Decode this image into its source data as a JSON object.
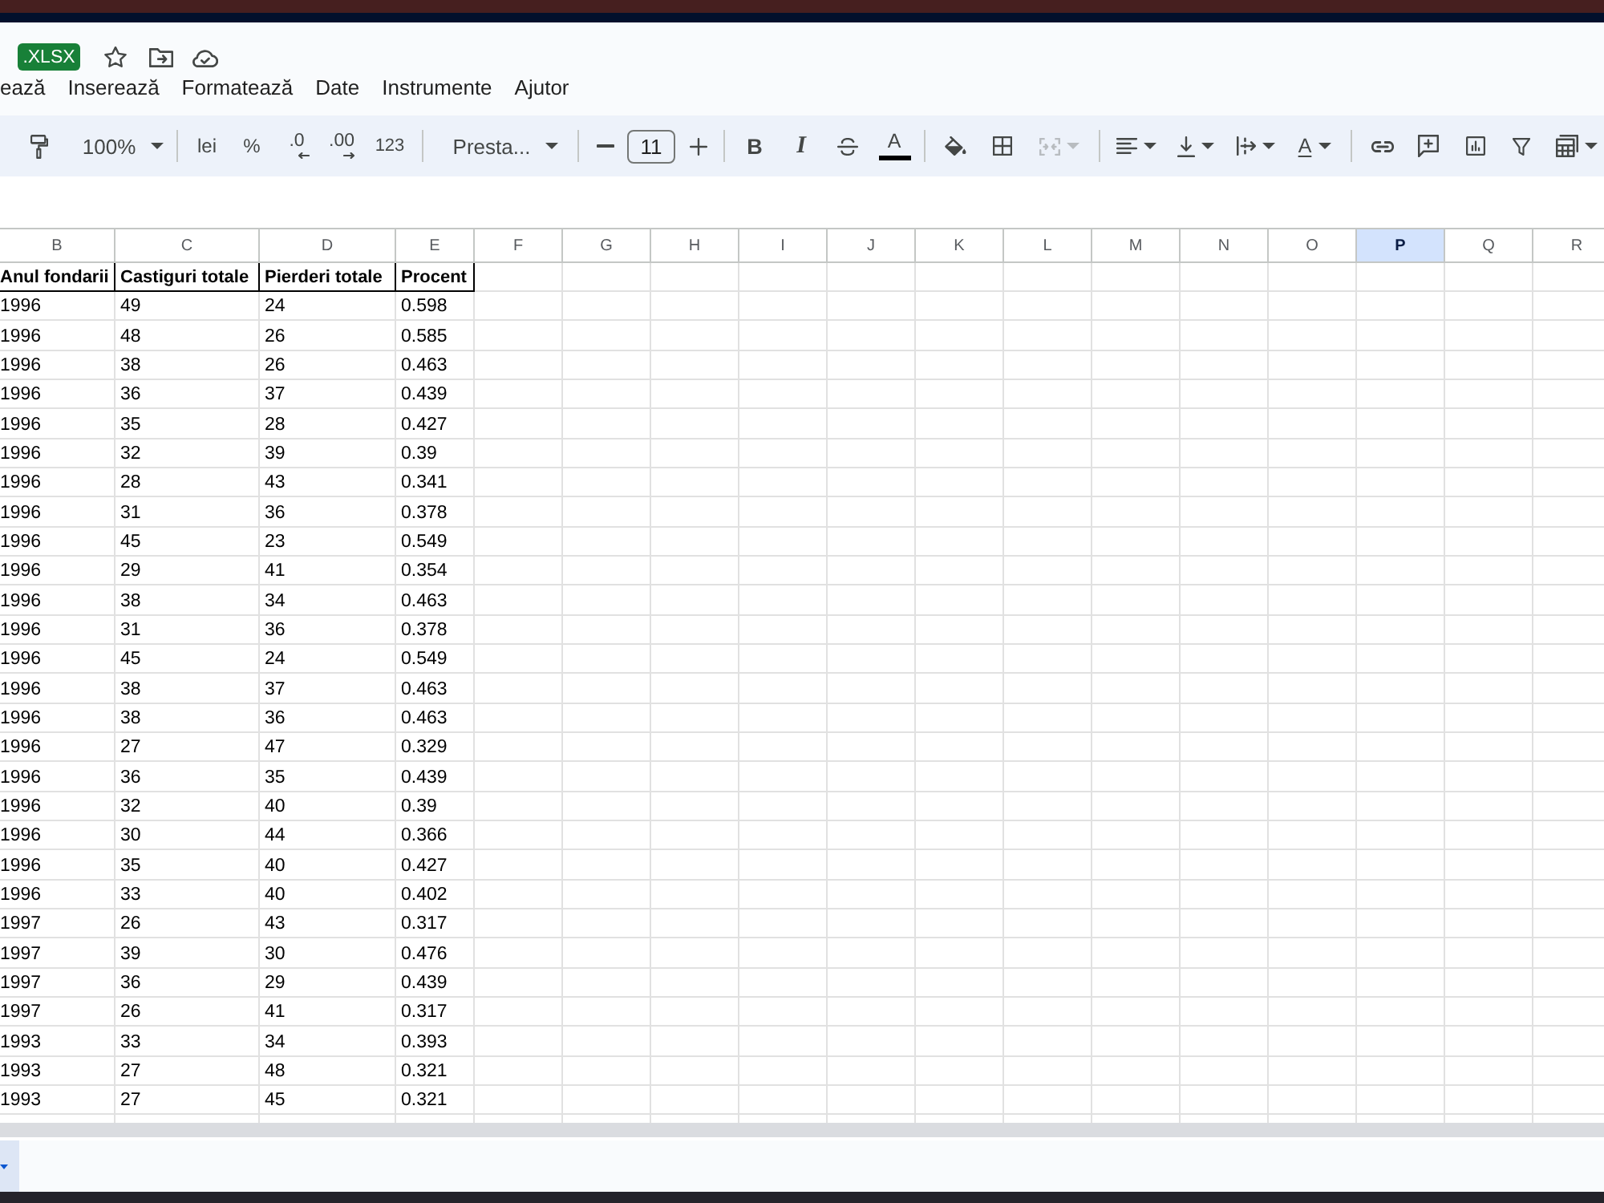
{
  "document": {
    "file_badge": ".XLSX"
  },
  "menu": [
    "ează",
    "Inserează",
    "Formatează",
    "Date",
    "Instrumente",
    "Ajutor"
  ],
  "toolbar": {
    "zoom": "100%",
    "currency": "lei",
    "percent": "%",
    "decrease_decimal": ".0",
    "increase_decimal": ".00",
    "number_format": "123",
    "font": "Presta...",
    "font_size": "11",
    "bold": "B",
    "italic": "I",
    "text_color": "A",
    "merge_cells": {
      "disabled": true
    },
    "text_rotation": "A"
  },
  "sheet": {
    "columns": [
      {
        "label": "B",
        "selected": false
      },
      {
        "label": "C",
        "selected": false
      },
      {
        "label": "D",
        "selected": false
      },
      {
        "label": "E",
        "selected": false
      },
      {
        "label": "F",
        "selected": false
      },
      {
        "label": "G",
        "selected": false
      },
      {
        "label": "H",
        "selected": false
      },
      {
        "label": "I",
        "selected": false
      },
      {
        "label": "J",
        "selected": false
      },
      {
        "label": "K",
        "selected": false
      },
      {
        "label": "L",
        "selected": false
      },
      {
        "label": "M",
        "selected": false
      },
      {
        "label": "N",
        "selected": false
      },
      {
        "label": "O",
        "selected": false
      },
      {
        "label": "P",
        "selected": true
      },
      {
        "label": "Q",
        "selected": false
      },
      {
        "label": "R",
        "selected": false
      }
    ],
    "header": [
      "Anul fondarii",
      "Castiguri totale",
      "Pierderi totale",
      "Procent"
    ],
    "rows": [
      [
        "1996",
        "49",
        "24",
        "0.598"
      ],
      [
        "1996",
        "48",
        "26",
        "0.585"
      ],
      [
        "1996",
        "38",
        "26",
        "0.463"
      ],
      [
        "1996",
        "36",
        "37",
        "0.439"
      ],
      [
        "1996",
        "35",
        "28",
        "0.427"
      ],
      [
        "1996",
        "32",
        "39",
        "0.39"
      ],
      [
        "1996",
        "28",
        "43",
        "0.341"
      ],
      [
        "1996",
        "31",
        "36",
        "0.378"
      ],
      [
        "1996",
        "45",
        "23",
        "0.549"
      ],
      [
        "1996",
        "29",
        "41",
        "0.354"
      ],
      [
        "1996",
        "38",
        "34",
        "0.463"
      ],
      [
        "1996",
        "31",
        "36",
        "0.378"
      ],
      [
        "1996",
        "45",
        "24",
        "0.549"
      ],
      [
        "1996",
        "38",
        "37",
        "0.463"
      ],
      [
        "1996",
        "38",
        "36",
        "0.463"
      ],
      [
        "1996",
        "27",
        "47",
        "0.329"
      ],
      [
        "1996",
        "36",
        "35",
        "0.439"
      ],
      [
        "1996",
        "32",
        "40",
        "0.39"
      ],
      [
        "1996",
        "30",
        "44",
        "0.366"
      ],
      [
        "1996",
        "35",
        "40",
        "0.427"
      ],
      [
        "1996",
        "33",
        "40",
        "0.402"
      ],
      [
        "1997",
        "26",
        "43",
        "0.317"
      ],
      [
        "1997",
        "39",
        "30",
        "0.476"
      ],
      [
        "1997",
        "36",
        "29",
        "0.439"
      ],
      [
        "1997",
        "26",
        "41",
        "0.317"
      ],
      [
        "1993",
        "33",
        "34",
        "0.393"
      ],
      [
        "1993",
        "27",
        "48",
        "0.321"
      ],
      [
        "1993",
        "27",
        "45",
        "0.321"
      ]
    ]
  }
}
